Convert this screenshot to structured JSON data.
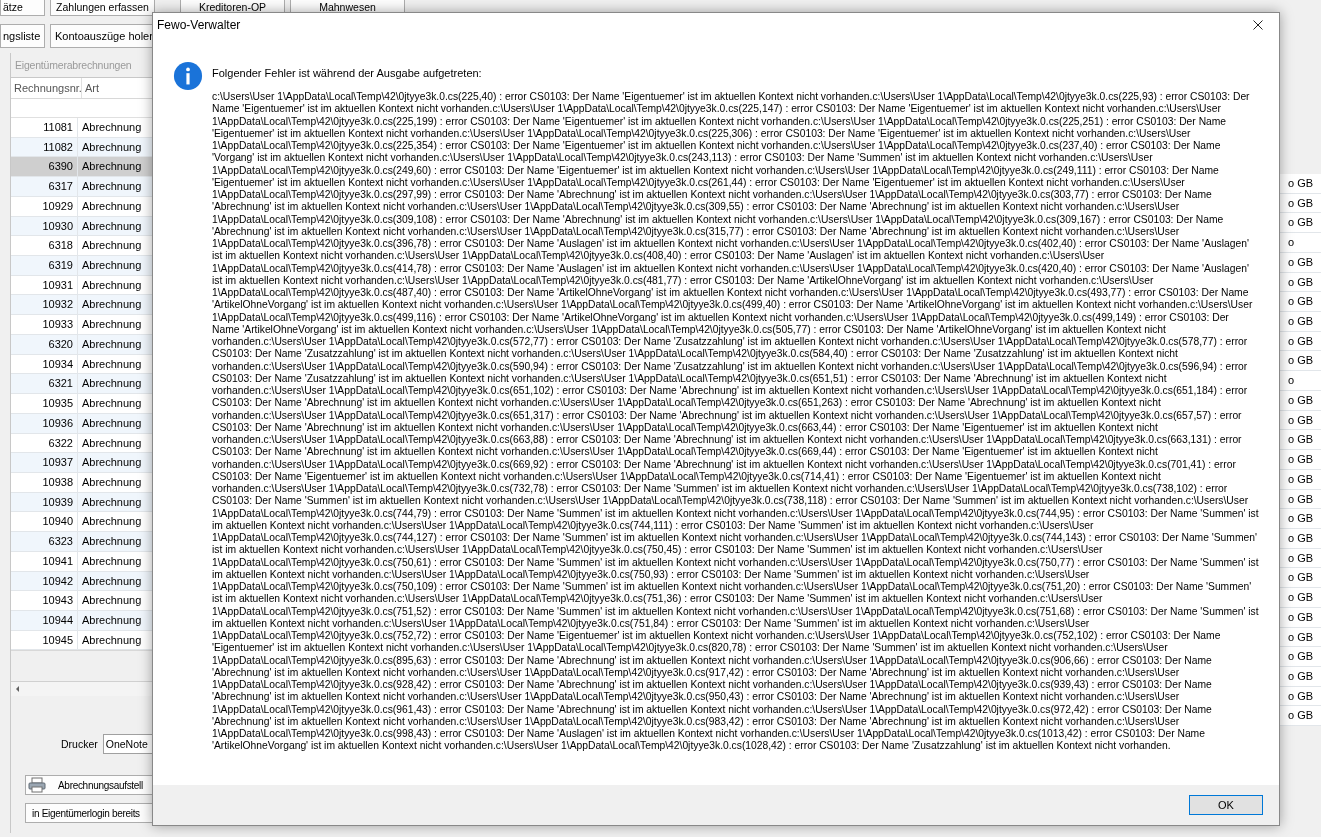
{
  "toolbar_rows": [
    [
      {
        "label": "ätze"
      },
      {
        "label": "Zahlungen erfassen"
      },
      {
        "label": "Kreditoren-OP"
      },
      {
        "label": "Mahnwesen"
      }
    ],
    [
      {
        "label": "ngsliste"
      },
      {
        "label": "Kontoauszüge holen"
      }
    ]
  ],
  "panel": {
    "title": "Eigentümerabrechnungen",
    "table": {
      "columns": [
        "Rechnungsnr.",
        "Art"
      ],
      "rows": [
        {
          "number": "11081",
          "type": "Abrechnung",
          "selected": false
        },
        {
          "number": "11082",
          "type": "Abrechnung",
          "selected": false
        },
        {
          "number": "6390",
          "type": "Abrechnung",
          "selected": true
        },
        {
          "number": "6317",
          "type": "Abrechnung",
          "selected": false
        },
        {
          "number": "10929",
          "type": "Abrechnung",
          "selected": false
        },
        {
          "number": "10930",
          "type": "Abrechnung",
          "selected": false
        },
        {
          "number": "6318",
          "type": "Abrechnung",
          "selected": false
        },
        {
          "number": "6319",
          "type": "Abrechnung",
          "selected": false
        },
        {
          "number": "10931",
          "type": "Abrechnung",
          "selected": false
        },
        {
          "number": "10932",
          "type": "Abrechnung",
          "selected": false
        },
        {
          "number": "10933",
          "type": "Abrechnung",
          "selected": false
        },
        {
          "number": "6320",
          "type": "Abrechnung",
          "selected": false
        },
        {
          "number": "10934",
          "type": "Abrechnung",
          "selected": false
        },
        {
          "number": "6321",
          "type": "Abrechnung",
          "selected": false
        },
        {
          "number": "10935",
          "type": "Abrechnung",
          "selected": false
        },
        {
          "number": "10936",
          "type": "Abrechnung",
          "selected": false
        },
        {
          "number": "6322",
          "type": "Abrechnung",
          "selected": false
        },
        {
          "number": "10937",
          "type": "Abrechnung",
          "selected": false
        },
        {
          "number": "10938",
          "type": "Abrechnung",
          "selected": false
        },
        {
          "number": "10939",
          "type": "Abrechnung",
          "selected": false
        },
        {
          "number": "10940",
          "type": "Abrechnung",
          "selected": false
        },
        {
          "number": "6323",
          "type": "Abrechnung",
          "selected": false
        },
        {
          "number": "10941",
          "type": "Abrechnung",
          "selected": false
        },
        {
          "number": "10942",
          "type": "Abrechnung",
          "selected": false
        },
        {
          "number": "10943",
          "type": "Abrechnung",
          "selected": false
        },
        {
          "number": "10944",
          "type": "Abrechnung",
          "selected": false
        },
        {
          "number": "10945",
          "type": "Abrechnung",
          "selected": false
        }
      ]
    },
    "printer_label": "Drucker",
    "printer_value": "OneNote",
    "buttons": [
      {
        "label": "Abrechnungsaufstell",
        "kind": "icon_button"
      },
      {
        "label": "in Eigentümerlogin bereits",
        "kind": "text_button"
      }
    ]
  },
  "right_column": [
    "o GB",
    "o GB",
    "o GB",
    "o",
    "o GB",
    "o GB",
    "o GB",
    "o GB",
    "o GB",
    "o GB",
    "o",
    "o GB",
    "o GB",
    "o GB",
    "o GB",
    "o GB",
    "o GB",
    "o GB",
    "o GB",
    "o GB",
    "o GB",
    "o GB",
    "o GB",
    "o GB",
    "o GB",
    "o GB",
    "o GB",
    "o GB"
  ],
  "dialog": {
    "title": "Fewo-Verwalter",
    "heading": "Folgender Fehler ist während der Ausgabe aufgetreten:",
    "message": "c:\\Users\\User 1\\AppData\\Local\\Temp\\42\\0jtyye3k.0.cs(225,40) : error CS0103: Der Name 'Eigentuemer' ist im aktuellen Kontext nicht vorhanden.c:\\Users\\User 1\\AppData\\Local\\Temp\\42\\0jtyye3k.0.cs(225,93) : error CS0103: Der Name 'Eigentuemer' ist im aktuellen Kontext nicht vorhanden.c:\\Users\\User 1\\AppData\\Local\\Temp\\42\\0jtyye3k.0.cs(225,147) : error CS0103: Der Name 'Eigentuemer' ist im aktuellen Kontext nicht vorhanden.c:\\Users\\User 1\\AppData\\Local\\Temp\\42\\0jtyye3k.0.cs(225,199) : error CS0103: Der Name 'Eigentuemer' ist im aktuellen Kontext nicht vorhanden.c:\\Users\\User 1\\AppData\\Local\\Temp\\42\\0jtyye3k.0.cs(225,251) : error CS0103: Der Name 'Eigentuemer' ist im aktuellen Kontext nicht vorhanden.c:\\Users\\User 1\\AppData\\Local\\Temp\\42\\0jtyye3k.0.cs(225,306) : error CS0103: Der Name 'Eigentuemer' ist im aktuellen Kontext nicht vorhanden.c:\\Users\\User 1\\AppData\\Local\\Temp\\42\\0jtyye3k.0.cs(225,354) : error CS0103: Der Name 'Eigentuemer' ist im aktuellen Kontext nicht vorhanden.c:\\Users\\User 1\\AppData\\Local\\Temp\\42\\0jtyye3k.0.cs(237,40) : error CS0103: Der Name 'Vorgang' ist im aktuellen Kontext nicht vorhanden.c:\\Users\\User 1\\AppData\\Local\\Temp\\42\\0jtyye3k.0.cs(243,113) : error CS0103: Der Name 'Summen' ist im aktuellen Kontext nicht vorhanden.c:\\Users\\User 1\\AppData\\Local\\Temp\\42\\0jtyye3k.0.cs(249,60) : error CS0103: Der Name 'Eigentuemer' ist im aktuellen Kontext nicht vorhanden.c:\\Users\\User 1\\AppData\\Local\\Temp\\42\\0jtyye3k.0.cs(249,111) : error CS0103: Der Name 'Eigentuemer' ist im aktuellen Kontext nicht vorhanden.c:\\Users\\User 1\\AppData\\Local\\Temp\\42\\0jtyye3k.0.cs(261,44) : error CS0103: Der Name 'Eigentuemer' ist im aktuellen Kontext nicht vorhanden.c:\\Users\\User 1\\AppData\\Local\\Temp\\42\\0jtyye3k.0.cs(297,99) : error CS0103: Der Name 'Abrechnung' ist im aktuellen Kontext nicht vorhanden.c:\\Users\\User 1\\AppData\\Local\\Temp\\42\\0jtyye3k.0.cs(303,77) : error CS0103: Der Name 'Abrechnung' ist im aktuellen Kontext nicht vorhanden.c:\\Users\\User 1\\AppData\\Local\\Temp\\42\\0jtyye3k.0.cs(309,55) : error CS0103: Der Name 'Abrechnung' ist im aktuellen Kontext nicht vorhanden.c:\\Users\\User 1\\AppData\\Local\\Temp\\42\\0jtyye3k.0.cs(309,108) : error CS0103: Der Name 'Abrechnung' ist im aktuellen Kontext nicht vorhanden.c:\\Users\\User 1\\AppData\\Local\\Temp\\42\\0jtyye3k.0.cs(309,167) : error CS0103: Der Name 'Abrechnung' ist im aktuellen Kontext nicht vorhanden.c:\\Users\\User 1\\AppData\\Local\\Temp\\42\\0jtyye3k.0.cs(315,77) : error CS0103: Der Name 'Abrechnung' ist im aktuellen Kontext nicht vorhanden.c:\\Users\\User 1\\AppData\\Local\\Temp\\42\\0jtyye3k.0.cs(396,78) : error CS0103: Der Name 'Auslagen' ist im aktuellen Kontext nicht vorhanden.c:\\Users\\User 1\\AppData\\Local\\Temp\\42\\0jtyye3k.0.cs(402,40) : error CS0103: Der Name 'Auslagen' ist im aktuellen Kontext nicht vorhanden.c:\\Users\\User 1\\AppData\\Local\\Temp\\42\\0jtyye3k.0.cs(408,40) : error CS0103: Der Name 'Auslagen' ist im aktuellen Kontext nicht vorhanden.c:\\Users\\User 1\\AppData\\Local\\Temp\\42\\0jtyye3k.0.cs(414,78) : error CS0103: Der Name 'Auslagen' ist im aktuellen Kontext nicht vorhanden.c:\\Users\\User 1\\AppData\\Local\\Temp\\42\\0jtyye3k.0.cs(420,40) : error CS0103: Der Name 'Auslagen' ist im aktuellen Kontext nicht vorhanden.c:\\Users\\User 1\\AppData\\Local\\Temp\\42\\0jtyye3k.0.cs(481,77) : error CS0103: Der Name 'ArtikelOhneVorgang' ist im aktuellen Kontext nicht vorhanden.c:\\Users\\User 1\\AppData\\Local\\Temp\\42\\0jtyye3k.0.cs(487,40) : error CS0103: Der Name 'ArtikelOhneVorgang' ist im aktuellen Kontext nicht vorhanden.c:\\Users\\User 1\\AppData\\Local\\Temp\\42\\0jtyye3k.0.cs(493,77) : error CS0103: Der Name 'ArtikelOhneVorgang' ist im aktuellen Kontext nicht vorhanden.c:\\Users\\User 1\\AppData\\Local\\Temp\\42\\0jtyye3k.0.cs(499,40) : error CS0103: Der Name 'ArtikelOhneVorgang' ist im aktuellen Kontext nicht vorhanden.c:\\Users\\User 1\\AppData\\Local\\Temp\\42\\0jtyye3k.0.cs(499,116) : error CS0103: Der Name 'ArtikelOhneVorgang' ist im aktuellen Kontext nicht vorhanden.c:\\Users\\User 1\\AppData\\Local\\Temp\\42\\0jtyye3k.0.cs(499,149) : error CS0103: Der Name 'ArtikelOhneVorgang' ist im aktuellen Kontext nicht vorhanden.c:\\Users\\User 1\\AppData\\Local\\Temp\\42\\0jtyye3k.0.cs(505,77) : error CS0103: Der Name 'ArtikelOhneVorgang' ist im aktuellen Kontext nicht vorhanden.c:\\Users\\User 1\\AppData\\Local\\Temp\\42\\0jtyye3k.0.cs(572,77) : error CS0103: Der Name 'Zusatzzahlung' ist im aktuellen Kontext nicht vorhanden.c:\\Users\\User 1\\AppData\\Local\\Temp\\42\\0jtyye3k.0.cs(578,77) : error CS0103: Der Name 'Zusatzzahlung' ist im aktuellen Kontext nicht vorhanden.c:\\Users\\User 1\\AppData\\Local\\Temp\\42\\0jtyye3k.0.cs(584,40) : error CS0103: Der Name 'Zusatzzahlung' ist im aktuellen Kontext nicht vorhanden.c:\\Users\\User 1\\AppData\\Local\\Temp\\42\\0jtyye3k.0.cs(590,94) : error CS0103: Der Name 'Zusatzzahlung' ist im aktuellen Kontext nicht vorhanden.c:\\Users\\User 1\\AppData\\Local\\Temp\\42\\0jtyye3k.0.cs(596,94) : error CS0103: Der Name 'Zusatzzahlung' ist im aktuellen Kontext nicht vorhanden.c:\\Users\\User 1\\AppData\\Local\\Temp\\42\\0jtyye3k.0.cs(651,51) : error CS0103: Der Name 'Abrechnung' ist im aktuellen Kontext nicht vorhanden.c:\\Users\\User 1\\AppData\\Local\\Temp\\42\\0jtyye3k.0.cs(651,102) : error CS0103: Der Name 'Abrechnung' ist im aktuellen Kontext nicht vorhanden.c:\\Users\\User 1\\AppData\\Local\\Temp\\42\\0jtyye3k.0.cs(651,184) : error CS0103: Der Name 'Abrechnung' ist im aktuellen Kontext nicht vorhanden.c:\\Users\\User 1\\AppData\\Local\\Temp\\42\\0jtyye3k.0.cs(651,263) : error CS0103: Der Name 'Abrechnung' ist im aktuellen Kontext nicht vorhanden.c:\\Users\\User 1\\AppData\\Local\\Temp\\42\\0jtyye3k.0.cs(651,317) : error CS0103: Der Name 'Abrechnung' ist im aktuellen Kontext nicht vorhanden.c:\\Users\\User 1\\AppData\\Local\\Temp\\42\\0jtyye3k.0.cs(657,57) : error CS0103: Der Name 'Abrechnung' ist im aktuellen Kontext nicht vorhanden.c:\\Users\\User 1\\AppData\\Local\\Temp\\42\\0jtyye3k.0.cs(663,44) : error CS0103: Der Name 'Eigentuemer' ist im aktuellen Kontext nicht vorhanden.c:\\Users\\User 1\\AppData\\Local\\Temp\\42\\0jtyye3k.0.cs(663,88) : error CS0103: Der Name 'Abrechnung' ist im aktuellen Kontext nicht vorhanden.c:\\Users\\User 1\\AppData\\Local\\Temp\\42\\0jtyye3k.0.cs(663,131) : error CS0103: Der Name 'Abrechnung' ist im aktuellen Kontext nicht vorhanden.c:\\Users\\User 1\\AppData\\Local\\Temp\\42\\0jtyye3k.0.cs(669,44) : error CS0103: Der Name 'Eigentuemer' ist im aktuellen Kontext nicht vorhanden.c:\\Users\\User 1\\AppData\\Local\\Temp\\42\\0jtyye3k.0.cs(669,92) : error CS0103: Der Name 'Abrechnung' ist im aktuellen Kontext nicht vorhanden.c:\\Users\\User 1\\AppData\\Local\\Temp\\42\\0jtyye3k.0.cs(701,41) : error CS0103: Der Name 'Eigentuemer' ist im aktuellen Kontext nicht vorhanden.c:\\Users\\User 1\\AppData\\Local\\Temp\\42\\0jtyye3k.0.cs(714,41) : error CS0103: Der Name 'Eigentuemer' ist im aktuellen Kontext nicht vorhanden.c:\\Users\\User 1\\AppData\\Local\\Temp\\42\\0jtyye3k.0.cs(732,78) : error CS0103: Der Name 'Summen' ist im aktuellen Kontext nicht vorhanden.c:\\Users\\User 1\\AppData\\Local\\Temp\\42\\0jtyye3k.0.cs(738,102) : error CS0103: Der Name 'Summen' ist im aktuellen Kontext nicht vorhanden.c:\\Users\\User 1\\AppData\\Local\\Temp\\42\\0jtyye3k.0.cs(738,118) : error CS0103: Der Name 'Summen' ist im aktuellen Kontext nicht vorhanden.c:\\Users\\User 1\\AppData\\Local\\Temp\\42\\0jtyye3k.0.cs(744,79) : error CS0103: Der Name 'Summen' ist im aktuellen Kontext nicht vorhanden.c:\\Users\\User 1\\AppData\\Local\\Temp\\42\\0jtyye3k.0.cs(744,95) : error CS0103: Der Name 'Summen' ist im aktuellen Kontext nicht vorhanden.c:\\Users\\User 1\\AppData\\Local\\Temp\\42\\0jtyye3k.0.cs(744,111) : error CS0103: Der Name 'Summen' ist im aktuellen Kontext nicht vorhanden.c:\\Users\\User 1\\AppData\\Local\\Temp\\42\\0jtyye3k.0.cs(744,127) : error CS0103: Der Name 'Summen' ist im aktuellen Kontext nicht vorhanden.c:\\Users\\User 1\\AppData\\Local\\Temp\\42\\0jtyye3k.0.cs(744,143) : error CS0103: Der Name 'Summen' ist im aktuellen Kontext nicht vorhanden.c:\\Users\\User 1\\AppData\\Local\\Temp\\42\\0jtyye3k.0.cs(750,45) : error CS0103: Der Name 'Summen' ist im aktuellen Kontext nicht vorhanden.c:\\Users\\User 1\\AppData\\Local\\Temp\\42\\0jtyye3k.0.cs(750,61) : error CS0103: Der Name 'Summen' ist im aktuellen Kontext nicht vorhanden.c:\\Users\\User 1\\AppData\\Local\\Temp\\42\\0jtyye3k.0.cs(750,77) : error CS0103: Der Name 'Summen' ist im aktuellen Kontext nicht vorhanden.c:\\Users\\User 1\\AppData\\Local\\Temp\\42\\0jtyye3k.0.cs(750,93) : error CS0103: Der Name 'Summen' ist im aktuellen Kontext nicht vorhanden.c:\\Users\\User 1\\AppData\\Local\\Temp\\42\\0jtyye3k.0.cs(750,109) : error CS0103: Der Name 'Summen' ist im aktuellen Kontext nicht vorhanden.c:\\Users\\User 1\\AppData\\Local\\Temp\\42\\0jtyye3k.0.cs(751,20) : error CS0103: Der Name 'Summen' ist im aktuellen Kontext nicht vorhanden.c:\\Users\\User 1\\AppData\\Local\\Temp\\42\\0jtyye3k.0.cs(751,36) : error CS0103: Der Name 'Summen' ist im aktuellen Kontext nicht vorhanden.c:\\Users\\User 1\\AppData\\Local\\Temp\\42\\0jtyye3k.0.cs(751,52) : error CS0103: Der Name 'Summen' ist im aktuellen Kontext nicht vorhanden.c:\\Users\\User 1\\AppData\\Local\\Temp\\42\\0jtyye3k.0.cs(751,68) : error CS0103: Der Name 'Summen' ist im aktuellen Kontext nicht vorhanden.c:\\Users\\User 1\\AppData\\Local\\Temp\\42\\0jtyye3k.0.cs(751,84) : error CS0103: Der Name 'Summen' ist im aktuellen Kontext nicht vorhanden.c:\\Users\\User 1\\AppData\\Local\\Temp\\42\\0jtyye3k.0.cs(752,72) : error CS0103: Der Name 'Eigentuemer' ist im aktuellen Kontext nicht vorhanden.c:\\Users\\User 1\\AppData\\Local\\Temp\\42\\0jtyye3k.0.cs(752,102) : error CS0103: Der Name 'Eigentuemer' ist im aktuellen Kontext nicht vorhanden.c:\\Users\\User 1\\AppData\\Local\\Temp\\42\\0jtyye3k.0.cs(820,78) : error CS0103: Der Name 'Summen' ist im aktuellen Kontext nicht vorhanden.c:\\Users\\User 1\\AppData\\Local\\Temp\\42\\0jtyye3k.0.cs(895,63) : error CS0103: Der Name 'Abrechnung' ist im aktuellen Kontext nicht vorhanden.c:\\Users\\User 1\\AppData\\Local\\Temp\\42\\0jtyye3k.0.cs(906,66) : error CS0103: Der Name 'Abrechnung' ist im aktuellen Kontext nicht vorhanden.c:\\Users\\User 1\\AppData\\Local\\Temp\\42\\0jtyye3k.0.cs(917,42) : error CS0103: Der Name 'Abrechnung' ist im aktuellen Kontext nicht vorhanden.c:\\Users\\User 1\\AppData\\Local\\Temp\\42\\0jtyye3k.0.cs(928,42) : error CS0103: Der Name 'Abrechnung' ist im aktuellen Kontext nicht vorhanden.c:\\Users\\User 1\\AppData\\Local\\Temp\\42\\0jtyye3k.0.cs(939,43) : error CS0103: Der Name 'Abrechnung' ist im aktuellen Kontext nicht vorhanden.c:\\Users\\User 1\\AppData\\Local\\Temp\\42\\0jtyye3k.0.cs(950,43) : error CS0103: Der Name 'Abrechnung' ist im aktuellen Kontext nicht vorhanden.c:\\Users\\User 1\\AppData\\Local\\Temp\\42\\0jtyye3k.0.cs(961,43) : error CS0103: Der Name 'Abrechnung' ist im aktuellen Kontext nicht vorhanden.c:\\Users\\User 1\\AppData\\Local\\Temp\\42\\0jtyye3k.0.cs(972,42) : error CS0103: Der Name 'Abrechnung' ist im aktuellen Kontext nicht vorhanden.c:\\Users\\User 1\\AppData\\Local\\Temp\\42\\0jtyye3k.0.cs(983,42) : error CS0103: Der Name 'Abrechnung' ist im aktuellen Kontext nicht vorhanden.c:\\Users\\User 1\\AppData\\Local\\Temp\\42\\0jtyye3k.0.cs(998,43) : error CS0103: Der Name 'Auslagen' ist im aktuellen Kontext nicht vorhanden.c:\\Users\\User 1\\AppData\\Local\\Temp\\42\\0jtyye3k.0.cs(1013,42) : error CS0103: Der Name 'ArtikelOhneVorgang' ist im aktuellen Kontext nicht vorhanden.c:\\Users\\User 1\\AppData\\Local\\Temp\\42\\0jtyye3k.0.cs(1028,42) : error CS0103: Der Name 'Zusatzzahlung' ist im aktuellen Kontext nicht vorhanden.",
    "button": "OK"
  }
}
